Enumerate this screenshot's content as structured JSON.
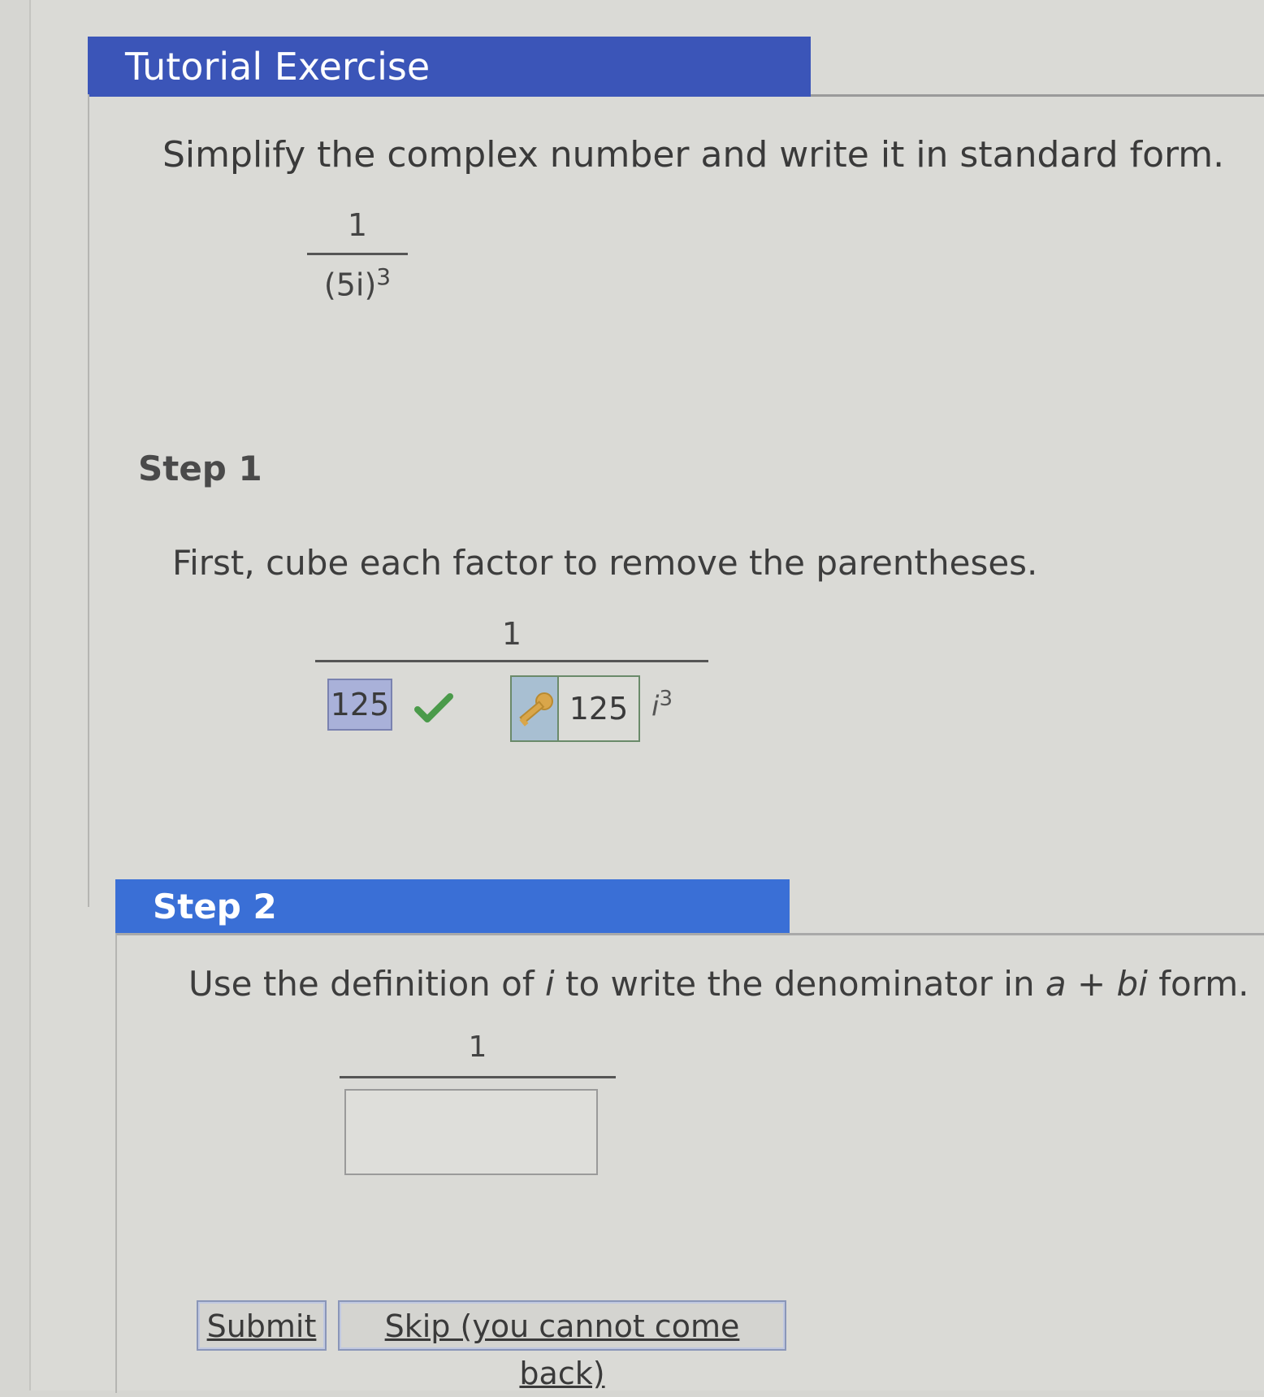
{
  "header": {
    "title": "Tutorial Exercise"
  },
  "problem": {
    "prompt": "Simplify the complex number and write it in standard form.",
    "numerator": "1",
    "denominator_base": "(5i)",
    "denominator_exponent": "3"
  },
  "step1": {
    "heading": "Step 1",
    "instruction": "First, cube each factor to remove the parentheses.",
    "numerator": "1",
    "answer_1": "125",
    "answer_2": "125",
    "i_symbol": "i",
    "i_exponent": "3",
    "check_icon": "check-icon",
    "key_icon": "key-icon"
  },
  "step2": {
    "heading": "Step 2",
    "instruction_pre": "Use the definition of ",
    "instruction_i": "i",
    "instruction_mid": " to write the denominator in ",
    "instruction_form": "a + bi",
    "instruction_post": " form.",
    "numerator": "1",
    "answer_value": ""
  },
  "actions": {
    "submit_label": "Submit",
    "skip_label": "Skip (you cannot come back)"
  },
  "colors": {
    "title_bar": "#3b55b8",
    "step2_bar": "#3a6fd6",
    "correct_box": "#a9b1d9",
    "check_green": "#4a9a4a"
  }
}
